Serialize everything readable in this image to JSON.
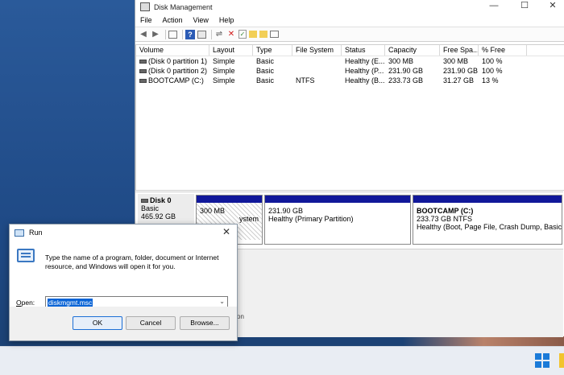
{
  "disk_mgmt": {
    "title": "Disk Management",
    "window_controls": [
      "—",
      "☐",
      "✕"
    ],
    "menu": [
      "File",
      "Action",
      "View",
      "Help"
    ],
    "toolbar_icons": [
      "back-arrow-icon",
      "forward-arrow-icon",
      "list-view-icon",
      "help-icon",
      "console-icon",
      "connect-icon",
      "delete-icon",
      "check-icon",
      "folder-up-icon",
      "folder-search-icon",
      "properties-icon"
    ],
    "columns": [
      "Volume",
      "Layout",
      "Type",
      "File System",
      "Status",
      "Capacity",
      "Free Spa...",
      "% Free"
    ],
    "rows": [
      [
        "(Disk 0 partition 1)",
        "Simple",
        "Basic",
        "",
        "Healthy (E...",
        "300 MB",
        "300 MB",
        "100 %"
      ],
      [
        "(Disk 0 partition 2)",
        "Simple",
        "Basic",
        "",
        "Healthy (P...",
        "231.90 GB",
        "231.90 GB",
        "100 %"
      ],
      [
        "BOOTCAMP (C:)",
        "Simple",
        "Basic",
        "NTFS",
        "Healthy (B...",
        "233.73 GB",
        "31.27 GB",
        "13 %"
      ]
    ],
    "disk": {
      "name": "Disk 0",
      "type": "Basic",
      "size": "465.92 GB",
      "partitions": [
        {
          "line1": "300 MB",
          "line2": "ystem"
        },
        {
          "line1": "231.90 GB",
          "line2": "Healthy (Primary Partition)"
        },
        {
          "title": "BOOTCAMP  (C:)",
          "line1": "233.73 GB NTFS",
          "line2": "Healthy (Boot, Page File, Crash Dump, Basic Da"
        }
      ]
    },
    "status_fragment": "tion"
  },
  "run": {
    "title": "Run",
    "close": "✕",
    "description": "Type the name of a program, folder, document or Internet resource, and Windows will open it for you.",
    "open_label_prefix": "O",
    "open_label_rest": "pen:",
    "input_value": "diskmgmt.msc",
    "dropdown_arrow": "⌄",
    "ok": "OK",
    "cancel": "Cancel",
    "browse": "Browse..."
  }
}
